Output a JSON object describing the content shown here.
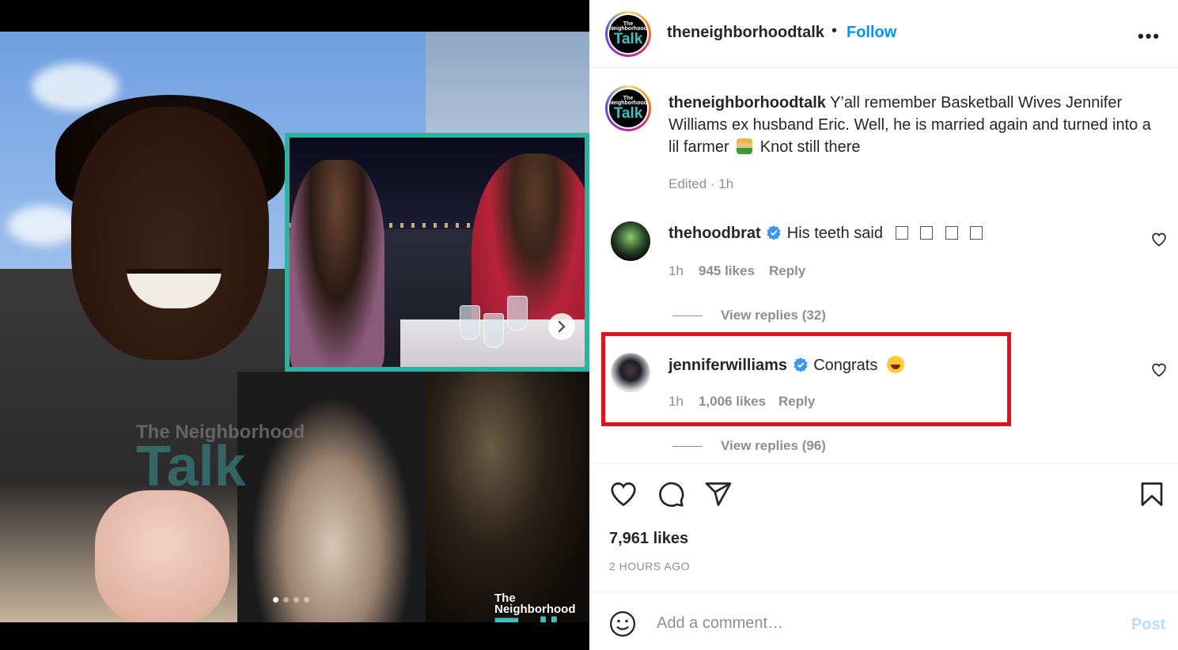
{
  "post": {
    "media": {
      "watermark_small": "The Neighborhood",
      "watermark_big": "Talk",
      "carousel_dots": [
        true,
        false,
        false,
        false
      ]
    },
    "header": {
      "username": "theneighborhoodtalk",
      "separator": "•",
      "follow_label": "Follow",
      "more_label": "•••",
      "avatar_small": "The Neighborhood",
      "avatar_big": "Talk"
    },
    "caption": {
      "username": "theneighborhoodtalk",
      "text_part1": "Y’all remember Basketball Wives Jennifer Williams ex husband Eric. Well, he is married again and turned into a lil farmer",
      "text_part2": "Knot still there",
      "meta": "Edited · 1h"
    },
    "comments": [
      {
        "username": "thehoodbrat",
        "verified": true,
        "text": "His teeth said",
        "time": "1h",
        "likes": "945 likes",
        "reply_label": "Reply",
        "view_replies": "View replies (32)"
      },
      {
        "username": "jenniferwilliams",
        "verified": true,
        "text": "Congrats",
        "time": "1h",
        "likes": "1,006 likes",
        "reply_label": "Reply",
        "view_replies": "View replies (96)"
      }
    ],
    "likes_count": "7,961 likes",
    "timestamp": "2 HOURS AGO",
    "comment_box": {
      "placeholder": "Add a comment…",
      "post_label": "Post"
    }
  },
  "colors": {
    "follow": "#0095f6",
    "highlight_box": "#e0121b",
    "verified": "#3897f0",
    "post_disabled": "#b2dffc"
  }
}
